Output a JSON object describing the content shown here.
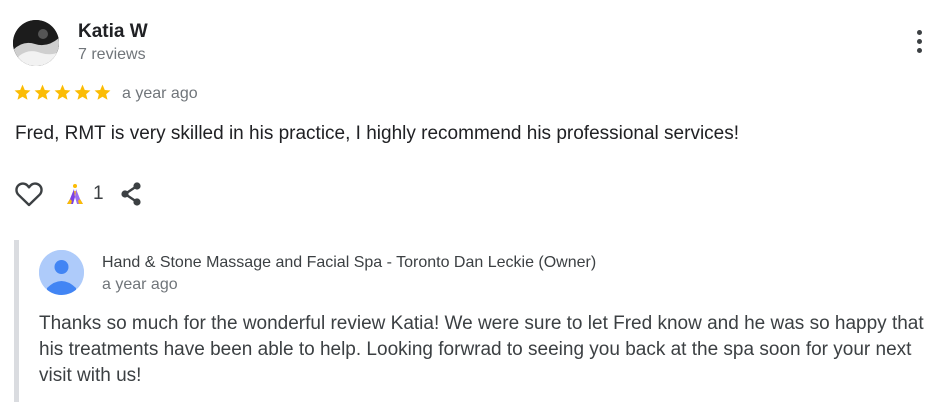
{
  "reviewer": {
    "name": "Katia W",
    "reviews_count": "7 reviews"
  },
  "review": {
    "rating": 5,
    "rating_max": 5,
    "star_color": "#fbbc04",
    "time": "a year ago",
    "text": "Fred, RMT is very skilled in his practice, I highly recommend his professional services!"
  },
  "actions": {
    "like_icon": "heart-icon",
    "reaction_icon": "praying-hands-icon",
    "reaction_count": "1",
    "share_icon": "share-icon",
    "more_icon": "more-vert-icon"
  },
  "owner_reply": {
    "responder": "Hand & Stone Massage and Facial Spa - Toronto Dan Leckie (Owner)",
    "time": "a year ago",
    "text": "Thanks so much for the wonderful review Katia! We were sure to let Fred know and he was so happy that his treatments have been able to help. Looking forwrad to seeing you back at the spa soon for your next visit with us!",
    "avatar_icon": "default-profile-icon",
    "avatar_color": "#aecbfa"
  }
}
